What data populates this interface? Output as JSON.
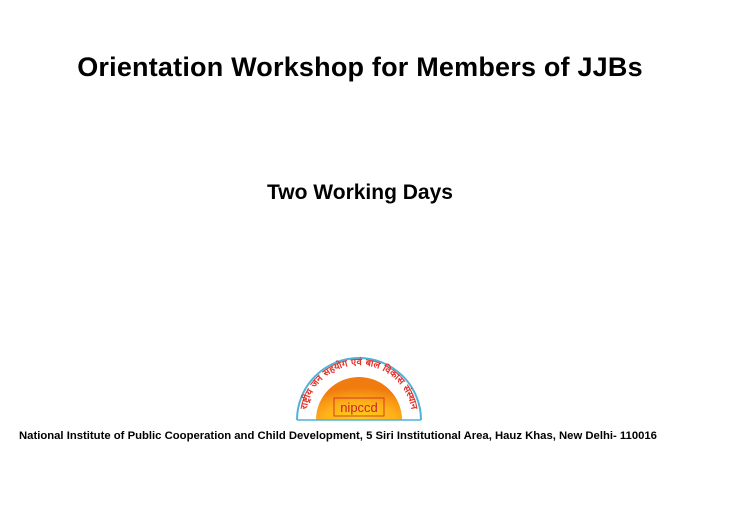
{
  "document": {
    "title": "Orientation Workshop for Members of JJBs",
    "subtitle": "Two Working Days",
    "footer_address": "National Institute of Public Cooperation and Child Development, 5 Siri Institutional Area, Hauz Khas, New Delhi- 110016"
  },
  "logo": {
    "icon": "nipccd-logo-icon",
    "arc_text": "राष्ट्रीय जन सहयोग एवं बाल विकास संस्थान",
    "wordmark": "nipccd",
    "colors": {
      "arc_text": "#e4332a",
      "arc_outline": "#4fb3d9",
      "sun_center": "#ffd21a",
      "sun_edge": "#f07c10",
      "wordmark": "#c8232b"
    }
  }
}
